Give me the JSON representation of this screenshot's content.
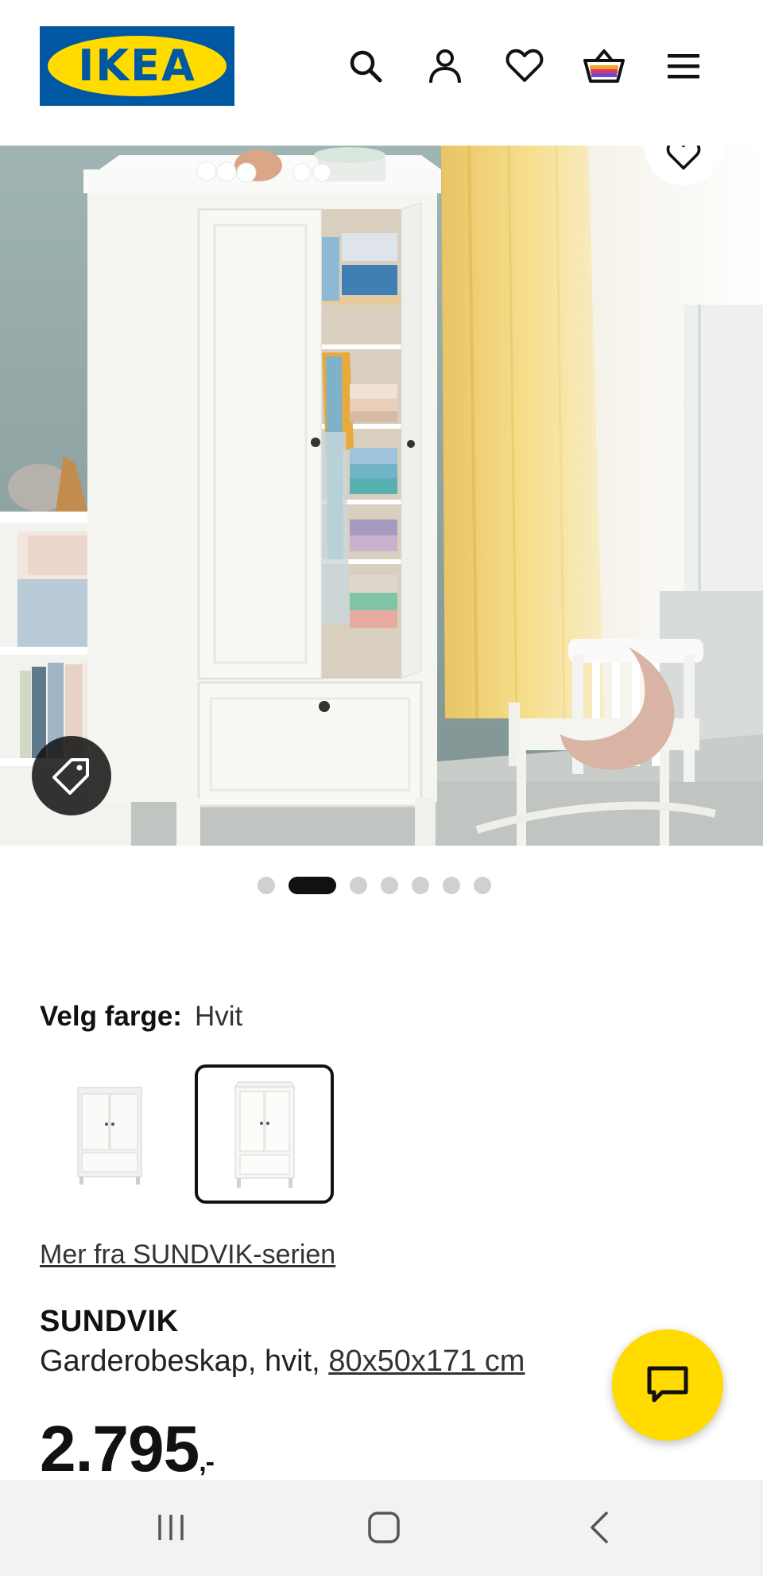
{
  "header": {
    "logo_text": "IKEA",
    "logo_reg": "®",
    "icons": [
      "search-icon",
      "account-icon",
      "heart-icon",
      "cart-icon",
      "menu-icon"
    ]
  },
  "hero": {
    "carousel_total": 7,
    "carousel_active_index": 1,
    "icons": [
      "favorite-heart-icon",
      "price-tag-icon"
    ]
  },
  "color": {
    "label": "Velg farge:",
    "value": "Hvit",
    "swatch_count": 2,
    "selected_index": 1
  },
  "series_link": "Mer fra SUNDVIK-serien",
  "product": {
    "name": "SUNDVIK",
    "description": "Garderobeskap, hvit, ",
    "dimensions": "80x50x171 cm",
    "price": "2.795",
    "price_suffix": ",-"
  },
  "chat": {
    "icon": "chat-icon"
  },
  "nav": {
    "icons": [
      "recents-icon",
      "home-icon",
      "back-icon"
    ]
  },
  "colors": {
    "ikea_blue": "#0058a3",
    "ikea_yellow": "#ffdb00",
    "text": "#111111"
  }
}
